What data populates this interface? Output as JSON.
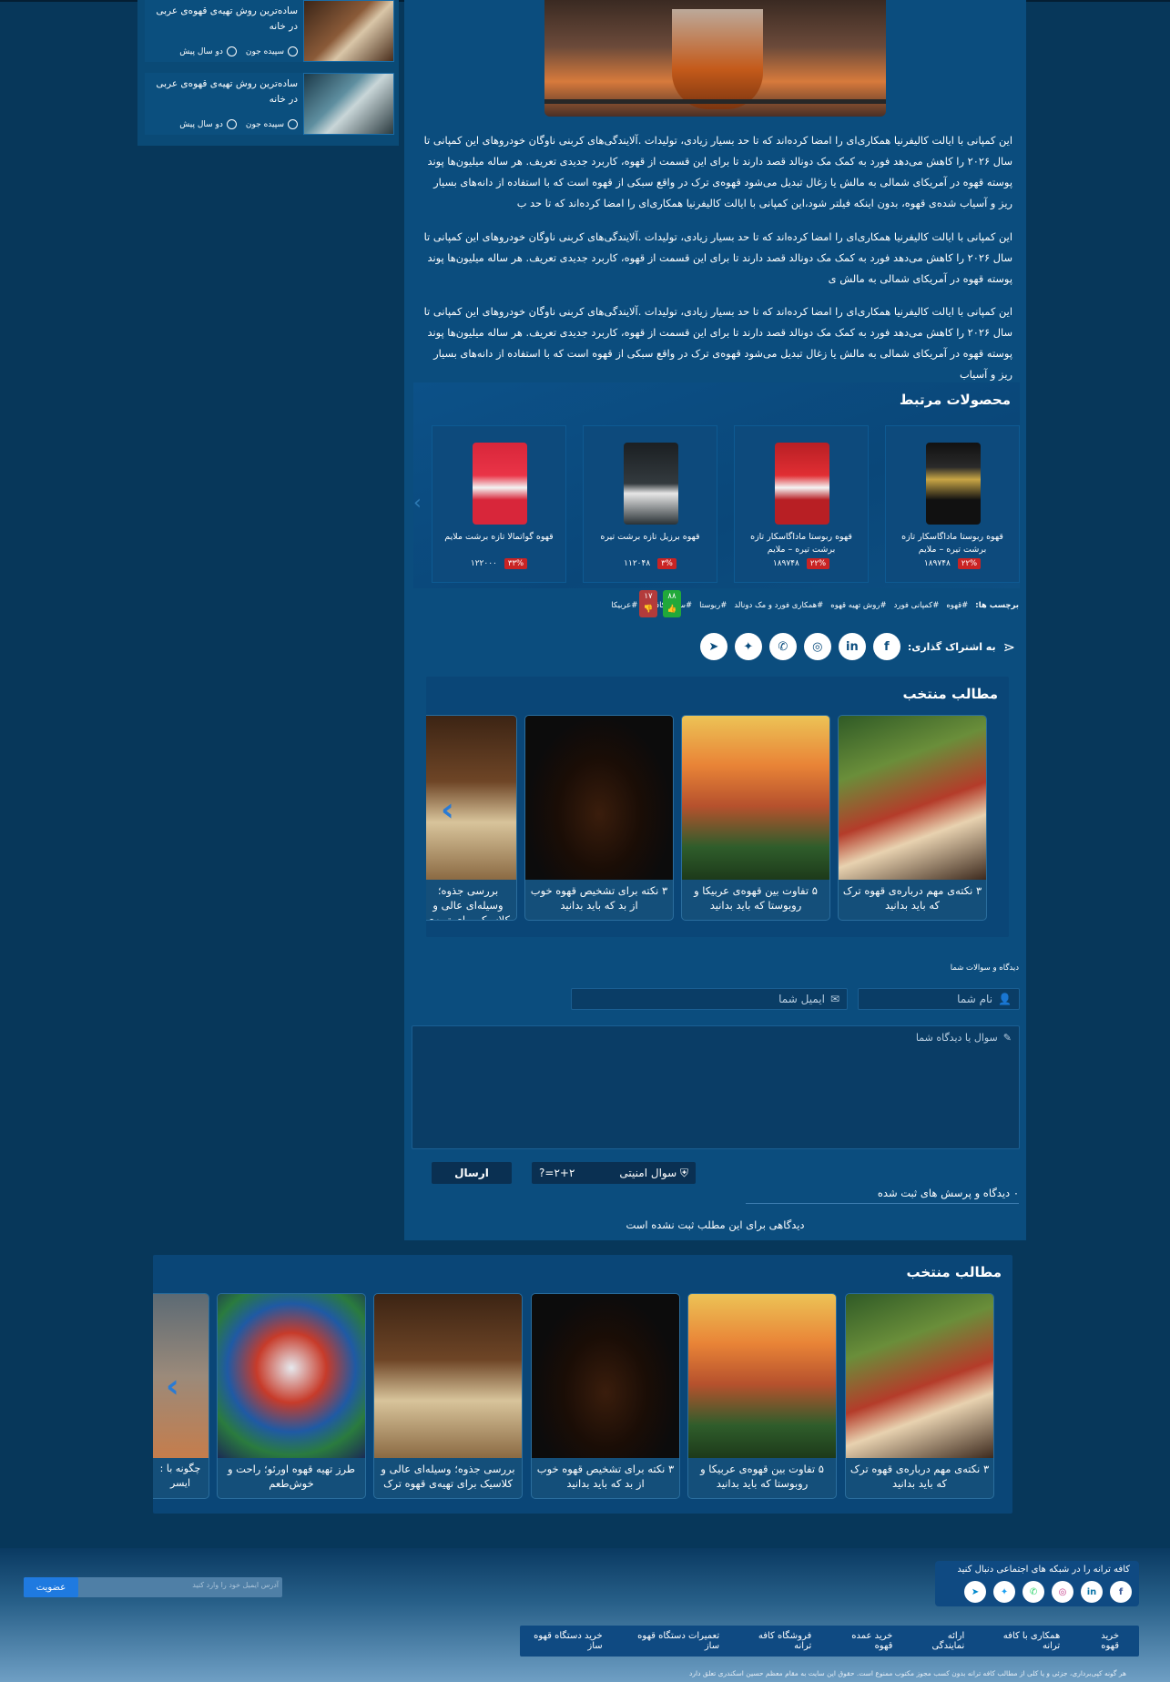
{
  "sidebar": {
    "items": [
      {
        "title": "ساده‌ترین روش تهیه‌ی قهوه‌ی عربی در خانه",
        "author": "سپیده جون",
        "time": "دو سال پیش"
      },
      {
        "title": "ساده‌ترین روش تهیه‌ی قهوه‌ی عربی در خانه",
        "author": "سپیده جون",
        "time": "دو سال پیش"
      }
    ]
  },
  "article": {
    "p1": "این کمپانی با ایالت کالیفرنیا همکاری‌ای را امضا کرده‌اند که تا حد بسیار زیادی، تولیدات .آلایندگی‌های کربنی ناوگان خودروهای این کمپانی تا سال ۲۰۲۶ را کاهش می‌دهد فورد به کمک مک دونالد قصد دارند تا برای این قسمت از قهوه، کاربرد جدیدی تعریف. هر ساله میلیون‌ها پوند پوسته قهوه در آمریکای شمالی به مالش یا زغال تبدیل می‌شود قهوه‌ی ترک در واقع سبکی از قهوه است که با استفاده از دانه‌های بسیار ریز و آسیاب شده‌ی قهوه، بدون اینکه فیلتر شود،این کمپانی با ایالت کالیفرنیا همکاری‌ای را امضا کرده‌اند که تا حد ب",
    "p2": "این کمپانی با ایالت کالیفرنیا همکاری‌ای را امضا کرده‌اند که تا حد بسیار زیادی، تولیدات .آلایندگی‌های کربنی ناوگان خودروهای این کمپانی تا سال ۲۰۲۶ را کاهش می‌دهد فورد به کمک مک دونالد قصد دارند تا برای این قسمت از قهوه، کاربرد جدیدی تعریف. هر ساله میلیون‌ها پوند پوسته قهوه در آمریکای شمالی به مالش ی",
    "p3": "این کمپانی با ایالت کالیفرنیا همکاری‌ای را امضا کرده‌اند که تا حد بسیار زیادی، تولیدات .آلایندگی‌های کربنی ناوگان خودروهای این کمپانی تا سال ۲۰۲۶ را کاهش می‌دهد فورد به کمک مک دونالد قصد دارند تا برای این قسمت از قهوه، کاربرد جدیدی تعریف. هر ساله میلیون‌ها پوند پوسته قهوه در آمریکای شمالی به مالش یا زغال تبدیل می‌شود قهوه‌ی ترک در واقع سبکی از قهوه است که با استفاده از دانه‌های بسیار ریز و آسیاب"
  },
  "related": {
    "title": "محصولات مرتبط",
    "products": [
      {
        "name": "قهوه ربوستا ماداگاسکار تازه برشت تیره – ملایم",
        "discount": "۲۲%",
        "price": "۱۸۹۷۴۸",
        "color": "#1a1a1a"
      },
      {
        "name": "قهوه ربوستا ماداگاسکار تازه برشت تیره – ملایم",
        "discount": "۲۲%",
        "price": "۱۸۹۷۴۸",
        "color": "#c9262a"
      },
      {
        "name": "قهوه برزیل تازه برشت تیره",
        "discount": "۳%",
        "price": "۱۱۲۰۴۸",
        "color": "#222a30"
      },
      {
        "name": "قهوه گواتمالا تازه برشت ملایم",
        "discount": "۳۳%",
        "price": "۱۲۲۰۰۰",
        "color": "#d8263a"
      }
    ]
  },
  "tags": {
    "label": "برچسب ها:",
    "items": [
      "#قهوه",
      "#کمپانی فورد",
      "#روش تهیه قهوه",
      "#همکاری فورد و مک دونالد",
      "#ربوستا",
      "#سطح کافئین",
      "#عربیکا"
    ]
  },
  "votes": {
    "up": "۸۸",
    "down": "۱۷"
  },
  "share": {
    "label": "به اشتراک گذاری:",
    "icons": [
      "facebook-icon",
      "linkedin-icon",
      "instagram-icon",
      "whatsapp-icon",
      "twitter-icon",
      "telegram-icon"
    ]
  },
  "featured1": {
    "title": "مطالب منتخب",
    "cards": [
      "۳ نکته‌ی مهم درباره‌ی قهوه ترک که باید بدانید",
      "۵ تفاوت بین قهوه‌ی عربیکا و روبوستا که باید بدانید",
      "۳ نکته برای تشخیص قهوه خوب از بد که باید بدانید",
      "بررسی جذوه؛ وسیله‌ای عالی و کلاسیک برای تهیه‌ی قهوه ترک"
    ]
  },
  "comments": {
    "section_label": "دیدگاه و سوالات شما",
    "name_placeholder": "نام شما",
    "email_placeholder": "ایمیل شما",
    "message_placeholder": "سوال یا دیدگاه شما",
    "captcha_label": "سوال امنیتی",
    "captcha_question": "۲+۲=?",
    "submit": "ارسال",
    "count_text": "۰ دیدگاه و پرسش های ثبت شده",
    "empty_text": "دیدگاهی برای این مطلب ثبت نشده است"
  },
  "featured2": {
    "title": "مطالب منتخب",
    "cards": [
      "۳ نکته‌ی مهم درباره‌ی قهوه ترک که باید بدانید",
      "۵ تفاوت بین قهوه‌ی عربیکا و روبوستا که باید بدانید",
      "۳ نکته برای تشخیص قهوه خوب از بد که باید بدانید",
      "بررسی جذوه؛ وسیله‌ای عالی و کلاسیک برای تهیه‌ی قهوه ترک",
      "طرز تهیه قهوه اورئو؛ راحت و خوش‌طعم",
      "چگونه با : ایسر"
    ]
  },
  "footer": {
    "follow_title": "کافه ترانه را در شبکه های اجتماعی دنبال کنید",
    "follow_icons": [
      "facebook-icon",
      "linkedin-icon",
      "instagram-icon",
      "whatsapp-icon",
      "twitter-icon",
      "telegram-icon"
    ],
    "newsletter_placeholder": "آدرس ایمیل خود را وارد کنید",
    "newsletter_button": "عضویت",
    "nav": [
      "خرید قهوه",
      "همکاری با کافه ترانه",
      "ارائه نمایندگی",
      "خرید عمده قهوه",
      "فروشگاه کافه ترانه",
      "تعمیرات دستگاه قهوه ساز",
      "خرید دستگاه قهوه ساز"
    ],
    "copyright": "هر گونه کپی‌برداری، جزئی و یا کلی از مطالب کافه ترانه بدون کسب مجوز مکتوب ممنوع است. حقوق این سایت به مقام معظم حسین اسکندری تعلق دارد"
  }
}
